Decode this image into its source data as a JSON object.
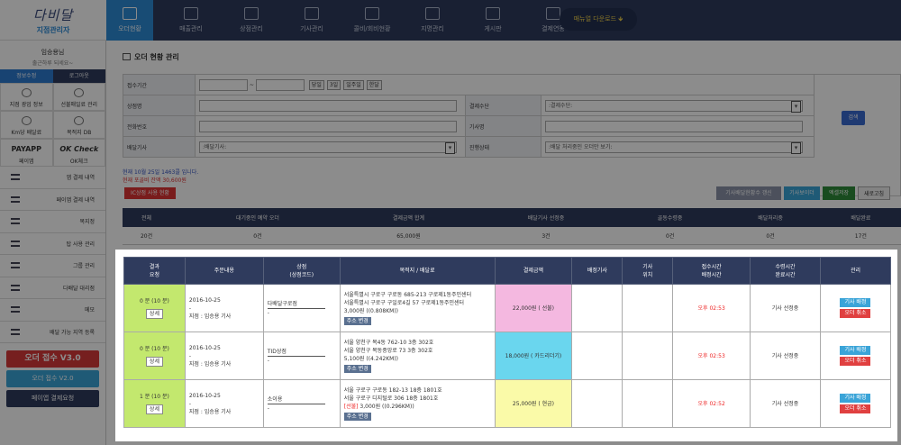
{
  "logo": {
    "line1": "다비달",
    "line2": "지점관리자"
  },
  "topnav": {
    "items": [
      "오더현황",
      "매출관리",
      "상점관리",
      "기사관리",
      "콜비/회비현황",
      "지명관리",
      "게시판",
      "결제연동"
    ],
    "download": "매뉴얼 다운로드 🡻"
  },
  "sidebar": {
    "greeting": "임승용님",
    "greeting_sub": "출근하루 되세요~",
    "btn_info": "정보수정",
    "btn_logout": "로그아웃",
    "grid": [
      "지점 광업 정보",
      "선불매일료 관리",
      "Km당 배달료",
      "목적지 DB"
    ],
    "payapp": "PAYAPP",
    "payapp_sub": "페이앱",
    "okcheck": "OK Check",
    "okcheck_sub": "OK체크",
    "menu": [
      "앱 결제 내역",
      "페이앱 결제 내역",
      "목지정",
      "탑 사용 관리",
      "그룹 관리",
      "다배달 대리점",
      "메모",
      "배달 가능 지역 등록"
    ],
    "order_v3": "오더 접수 V3.0",
    "order_v2": "오더 접수 V2.0",
    "payapp_pay": "페이앱 결제요청"
  },
  "main": {
    "title": "오더 현황 관리",
    "filter": {
      "period_label": "접수기간",
      "tilde": "~",
      "quick": [
        "당일",
        "3일",
        "일주일",
        "한달"
      ],
      "store_label": "상점명",
      "payment_label": "결제수단",
      "payment_value": ":결제수단:",
      "phone_label": "전화번호",
      "driver_name_label": "기사명",
      "driver_label": "배달기사",
      "driver_value": ":배달기사:",
      "status_label": "진행상태",
      "status_value": ":배달 처리중인 오더만 보기:",
      "search": "검색"
    },
    "info_line1": "현재 10월 25일 1463콜 입니다.",
    "info_line2": "현재 포골비 잔액 30,600원",
    "ic_button": "IC상점 사용 현황",
    "actions": [
      "기사배달현황수 갱신",
      "기사보이더",
      "엑셀저장",
      "새로고침"
    ],
    "stats_headers": [
      "전체",
      "대기중인 예약 오더",
      "결제금액 합계",
      "배달기사 선정중",
      "골동수령중",
      "배달처리중",
      "배달완료"
    ],
    "stats_values": [
      "20건",
      "0건",
      "65,000원",
      "3건",
      "0건",
      "0건",
      "17건"
    ]
  },
  "orders": {
    "headers": [
      "결과\n요청",
      "주문내용",
      "상점\n(상점코드)",
      "목적지 / 배달료",
      "결제금액",
      "배정기사",
      "기사\n위치",
      "접수시간\n배정시간",
      "수령시간\n완료시간",
      "관리"
    ],
    "rows": [
      {
        "wait": "0 분 (10 분)",
        "detail": "상세",
        "date": "2016-10-25",
        "dash": "-",
        "branch": "지점 : 임승용 기사",
        "store": "다배달구로점",
        "store_code": "-",
        "addr1": "서울특별시 구로구 구로동 685-213 구로제1동주민센터",
        "addr2": "서울특별시 구로구 구일로4길 57 구로제1동주민센터",
        "fee": "3,000원 ((0.808KM))",
        "fee_tag": "",
        "addr_btn": "주소 변경",
        "amount": "22,000원 ( 선불)",
        "amount_color": "#f4b8e0",
        "time": "오후 02:53",
        "status": "기사 선정중",
        "btn_assign": "기사 배정",
        "btn_cancel": "오더 취소"
      },
      {
        "wait": "0 분 (10 분)",
        "detail": "상세",
        "date": "2016-10-25",
        "dash": "-",
        "branch": "지점 : 임승용 기사",
        "store": "TID상점",
        "store_code": "-",
        "addr1": "서울 양천구 목4동 762-10 3층 302호",
        "addr2": "서울 양천구 목동중앙로 73 3층 302호",
        "fee": "5,100원 ((4.242KM))",
        "fee_tag": "",
        "addr_btn": "주소 변경",
        "amount": "18,000원 ( 카드리더기)",
        "amount_color": "#6ad6ee",
        "time": "오후 02:53",
        "status": "기사 선정중",
        "btn_assign": "기사 배정",
        "btn_cancel": "오더 취소"
      },
      {
        "wait": "1 분 (10 분)",
        "detail": "상세",
        "date": "2016-10-25",
        "dash": "-",
        "branch": "지점 : 임승용 기사",
        "store": "소이용",
        "store_code": "-",
        "addr1": "서울 구로구 구로동 182-13 18층 1801호",
        "addr2": "서울 구로구 디지털로 306 18층 1801호",
        "fee": "3,000원 ((0.296KM))",
        "fee_tag": "[선불]",
        "addr_btn": "주소 변경",
        "amount": "25,000원 ( 현금)",
        "amount_color": "#fafaa8",
        "time": "오후 02:52",
        "status": "기사 선정중",
        "btn_assign": "기사 배정",
        "btn_cancel": "오더 취소"
      }
    ]
  },
  "colors": {
    "nav": "#2e3b5e",
    "active": "#2d8ad6",
    "highlight_wait": "#c3e86e"
  }
}
